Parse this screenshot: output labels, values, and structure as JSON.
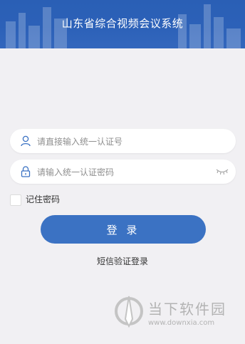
{
  "header": {
    "title": "山东省综合视频会议系统"
  },
  "login_form": {
    "username_placeholder": "请直接输入统一认证号",
    "password_placeholder": "请输入统一认证密码",
    "remember_label": "记住密码",
    "remember_checked": false,
    "login_button": "登 录",
    "sms_login": "短信验证登录"
  },
  "icons": {
    "username": "user-icon",
    "password": "lock-icon",
    "visibility": "eye-closed-icon"
  },
  "watermark": {
    "name": "当下软件园",
    "url": "www.downxia.com"
  },
  "colors": {
    "header_bg": "#2c61b8",
    "button_bg": "#3b72c3",
    "field_icon": "#3b72c3",
    "page_bg": "#f1f0f3"
  }
}
